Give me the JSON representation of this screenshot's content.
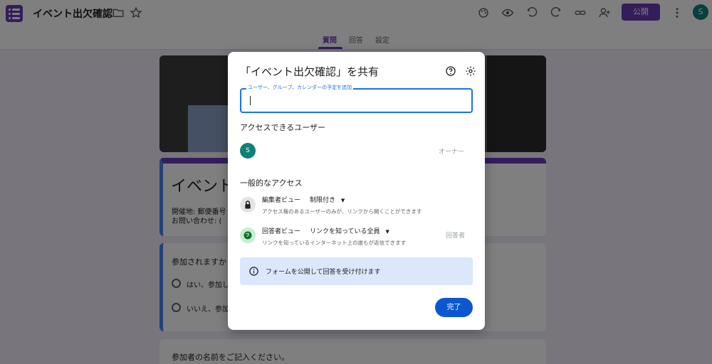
{
  "app": {
    "title": "イベント出欠確認",
    "publish_label": "公開",
    "avatar_initial": "S",
    "accent": "#673ab7"
  },
  "toolbar": {
    "icons": [
      "palette-icon",
      "preview-icon",
      "undo-icon",
      "redo-icon",
      "link-icon",
      "add-collaborator-icon",
      "more-icon"
    ]
  },
  "tabs": [
    {
      "label": "質問",
      "active": true
    },
    {
      "label": "回答",
      "active": false
    },
    {
      "label": "設定",
      "active": false
    }
  ],
  "form": {
    "title": "イベント",
    "desc_line1": "開催地: 郵便番号",
    "desc_line2": "お問い合わせ: (",
    "q1": "参加されますか",
    "q1_opt1": "はい、参加し",
    "q1_opt2": "いいえ、参加",
    "q2": "参加者の名前をご記入ください。"
  },
  "dialog": {
    "title": "「イベント出欠確認」を共有",
    "input_label": "ユーザー、グループ、カレンダーの予定を追加",
    "input_value": "",
    "access_users_heading": "アクセスできるユーザー",
    "user_initial": "S",
    "owner_label": "オーナー",
    "general_access_heading": "一般的なアクセス",
    "editor_view": "編集者ビュー",
    "editor_access": "制限付き",
    "editor_desc": "アクセス権のあるユーザーのみが、リンクから開くことができます",
    "responder_view": "回答者ビュー",
    "responder_access": "リンクを知っている全員",
    "responder_desc": "リンクを知っているインターネット上の誰もが返信できます",
    "responder_role": "回答者",
    "info_text": "フォームを公開して回答を受け付けます",
    "done_label": "完了"
  }
}
